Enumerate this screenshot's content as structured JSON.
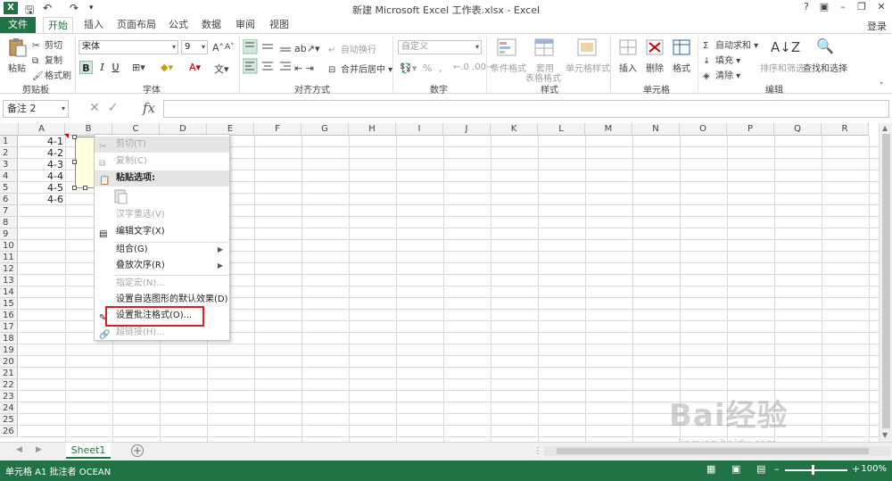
{
  "title_bar": {
    "title": "新建 Microsoft Excel 工作表.xlsx - Excel",
    "help": "?",
    "minimize": "–",
    "restore": "❐",
    "close": "✕"
  },
  "tabs": {
    "file": "文件",
    "items": [
      "开始",
      "插入",
      "页面布局",
      "公式",
      "数据",
      "审阅",
      "视图"
    ],
    "login": "登录"
  },
  "ribbon": {
    "clipboard": {
      "paste": "粘贴",
      "cut": "剪切",
      "copy": "复制",
      "format_painter": "格式刷",
      "label": "剪贴板"
    },
    "font": {
      "name": "宋体",
      "size": "9",
      "bold": "B",
      "italic": "I",
      "underline": "U",
      "label": "字体",
      "grow": "A",
      "shrink": "A"
    },
    "alignment": {
      "wrap": "自动换行",
      "merge": "合并后居中",
      "label": "对齐方式"
    },
    "number": {
      "format": "自定义",
      "percent": "%",
      "comma": ",",
      "label": "数字"
    },
    "styles": {
      "conditional": "条件格式",
      "table_line1": "套用",
      "table_line2": "表格格式",
      "cell_styles": "单元格样式",
      "label": "样式"
    },
    "cells": {
      "insert": "插入",
      "delete": "删除",
      "format": "格式",
      "label": "单元格"
    },
    "editing": {
      "autosum": "自动求和",
      "fill": "填充",
      "clear": "清除",
      "sort": "排序和筛选",
      "find": "查找和选择",
      "label": "编辑"
    }
  },
  "formula_bar": {
    "name_box": "备注 2",
    "fx": "fx",
    "value": ""
  },
  "grid": {
    "columns": [
      "A",
      "B",
      "C",
      "D",
      "E",
      "F",
      "G",
      "H",
      "I",
      "J",
      "K",
      "L",
      "M",
      "N",
      "O",
      "P",
      "Q",
      "R"
    ],
    "rows": [
      "1",
      "2",
      "3",
      "4",
      "5",
      "6",
      "7",
      "8",
      "9",
      "10",
      "11",
      "12",
      "13",
      "14",
      "15",
      "16",
      "17",
      "18",
      "19",
      "20",
      "21",
      "22",
      "23",
      "24",
      "25",
      "26"
    ],
    "cells_a": [
      "4-1",
      "4-2",
      "4-3",
      "4-4",
      "4-5",
      "4-6"
    ]
  },
  "context_menu": {
    "items": [
      {
        "label": "剪切(T)",
        "disabled": true
      },
      {
        "label": "复制(C)",
        "disabled": true
      },
      {
        "label": "粘贴选项:",
        "disabled": false,
        "bold": true
      },
      {
        "label": "汉字重选(V)",
        "disabled": true
      },
      {
        "label": "编辑文字(X)",
        "disabled": false
      },
      {
        "label": "组合(G)",
        "disabled": false,
        "submenu": true
      },
      {
        "label": "叠放次序(R)",
        "disabled": false,
        "submenu": true
      },
      {
        "label": "指定宏(N)...",
        "disabled": true
      },
      {
        "label": "设置自选图形的默认效果(D)",
        "disabled": false
      },
      {
        "label": "设置批注格式(O)...",
        "disabled": false
      },
      {
        "label": "超链接(H)...",
        "disabled": true
      }
    ],
    "submenu_arrow": "▶"
  },
  "sheets": {
    "active": "Sheet1",
    "add": "+"
  },
  "status_bar": {
    "text": "单元格 A1 批注者 OCEAN",
    "zoom": "100%",
    "minus": "–",
    "plus": "+"
  },
  "watermark": {
    "main": "Bai经验",
    "sub": "jingyan.baidu.com"
  },
  "colors": {
    "excel_green": "#217346",
    "highlight_red": "#e02020",
    "comment_yellow": "#ffffe1"
  }
}
